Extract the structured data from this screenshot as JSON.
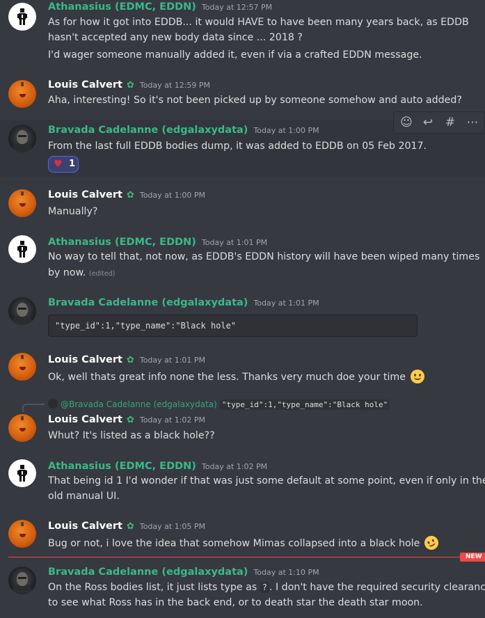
{
  "messages": [
    {
      "author": "Athanasius (EDMC, EDDN)",
      "time": "Today at 12:57 PM",
      "lines": [
        "As for how it got into EDDB... it would HAVE to have been many years back, as EDDB",
        "hasn't accepted any new body data since ... 2018 ?",
        "I'd wager someone manually added it, even if via a crafted EDDN message."
      ]
    },
    {
      "author": "Louis Calvert",
      "time": "Today at 12:59 PM",
      "lines": [
        "Aha, interesting! So it's not been picked up by someone somehow and auto added?"
      ]
    },
    {
      "author": "Bravada Cadelanne (edgalaxydata)",
      "time": "Today at 1:00 PM",
      "lines": [
        "From the last full EDDB bodies dump, it was added to EDDB on 05 Feb 2017."
      ],
      "reaction": {
        "emoji": "heart",
        "count": "1"
      }
    },
    {
      "author": "Louis Calvert",
      "time": "Today at 1:00 PM",
      "lines": [
        "Manually?"
      ]
    },
    {
      "author": "Athanasius (EDMC, EDDN)",
      "time": "Today at 1:01 PM",
      "lines": [
        "No way to tell that, not now, as EDDB's EDDN history will have been wiped many times",
        "by now."
      ],
      "edited": "(edited)"
    },
    {
      "author": "Bravada Cadelanne (edgalaxydata)",
      "time": "Today at 1:01 PM",
      "code": "\"type_id\":1,\"type_name\":\"Black hole\""
    },
    {
      "author": "Louis Calvert",
      "time": "Today at 1:01 PM",
      "lines": [
        "Ok, well thats great info none the less. Thanks very much doe your time"
      ],
      "emoji": "slightly-smiling-face"
    },
    {
      "author": "Louis Calvert",
      "time": "Today at 1:02 PM",
      "reply": {
        "mention": "@Bravada Cadelanne (edgalaxydata)",
        "code": "\"type_id\":1,\"type_name\":\"Black hole\""
      },
      "lines": [
        "Whut? It's listed as a black hole??"
      ]
    },
    {
      "author": "Athanasius (EDMC, EDDN)",
      "time": "Today at 1:02 PM",
      "lines": [
        "That being id 1 I'd wonder if that was just some default at some point, even if only in the",
        "old manual UI."
      ]
    },
    {
      "author": "Louis Calvert",
      "time": "Today at 1:05 PM",
      "lines": [
        "Bug or not, i love the idea that somehow Mimas collapsed into a black hole"
      ],
      "emoji": "rolling-on-floor-laughing"
    },
    {
      "author": "Bravada Cadelanne (edgalaxydata)",
      "time": "Today at 1:10 PM",
      "lines_a": "On the Ross bodies list, it just lists type as",
      "inline_code": "?",
      "lines_b": ". I don't have the required security clearance",
      "line2": "to see what Ross has in the back end, or to death star the death star moon."
    }
  ],
  "new_label": "NEW",
  "colors": {
    "author_green": "#3bb88a",
    "author_white": "#ffffff",
    "new_red": "#f04747",
    "background": "#36393f"
  }
}
